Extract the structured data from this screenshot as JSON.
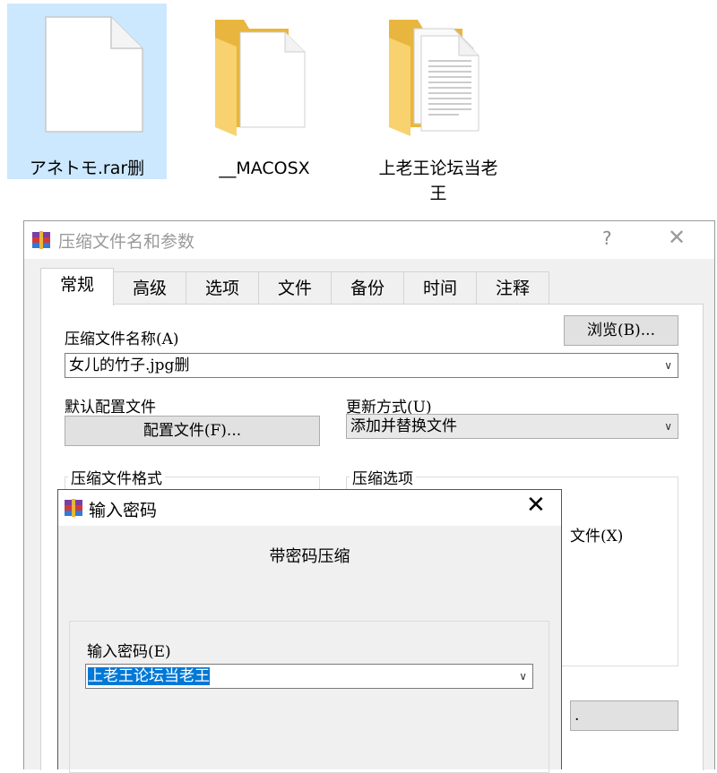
{
  "desktop": {
    "files": [
      {
        "label": "アネトモ.rar删",
        "type": "file",
        "selected": true
      },
      {
        "label": "__MACOSX",
        "type": "folder",
        "selected": false
      },
      {
        "label": "上老王论坛当老王",
        "type": "folder-with-documents",
        "selected": false
      }
    ]
  },
  "main_window": {
    "title": "压缩文件名和参数",
    "help": "?",
    "close": "✕",
    "tabs": [
      {
        "label": "常规",
        "active": true
      },
      {
        "label": "高级",
        "active": false
      },
      {
        "label": "选项",
        "active": false
      },
      {
        "label": "文件",
        "active": false
      },
      {
        "label": "备份",
        "active": false
      },
      {
        "label": "时间",
        "active": false
      },
      {
        "label": "注释",
        "active": false
      }
    ],
    "archive_name_label": "压缩文件名称(A)",
    "browse_button": "浏览(B)...",
    "archive_name_value": "女儿的竹子.jpg删",
    "default_profile_label": "默认配置文件",
    "profiles_button": "配置文件(F)...",
    "update_mode_label": "更新方式(U)",
    "update_mode_value": "添加并替换文件",
    "archive_format_label": "压缩文件格式",
    "archive_options_label": "压缩选项",
    "partial_option_text": "文件(X)",
    "partial_button_text": "."
  },
  "password_dialog": {
    "title": "输入密码",
    "close": "✕",
    "heading": "带密码压缩",
    "password_label": "输入密码(E)",
    "password_value": "上老王论坛当老王"
  },
  "colors": {
    "selection_bg": "#cce8ff",
    "text_highlight": "#0078d7",
    "folder_yellow": "#f7d26f"
  },
  "icons": {
    "app": "winrar-icon",
    "dropdown": "chevron-down-icon"
  }
}
